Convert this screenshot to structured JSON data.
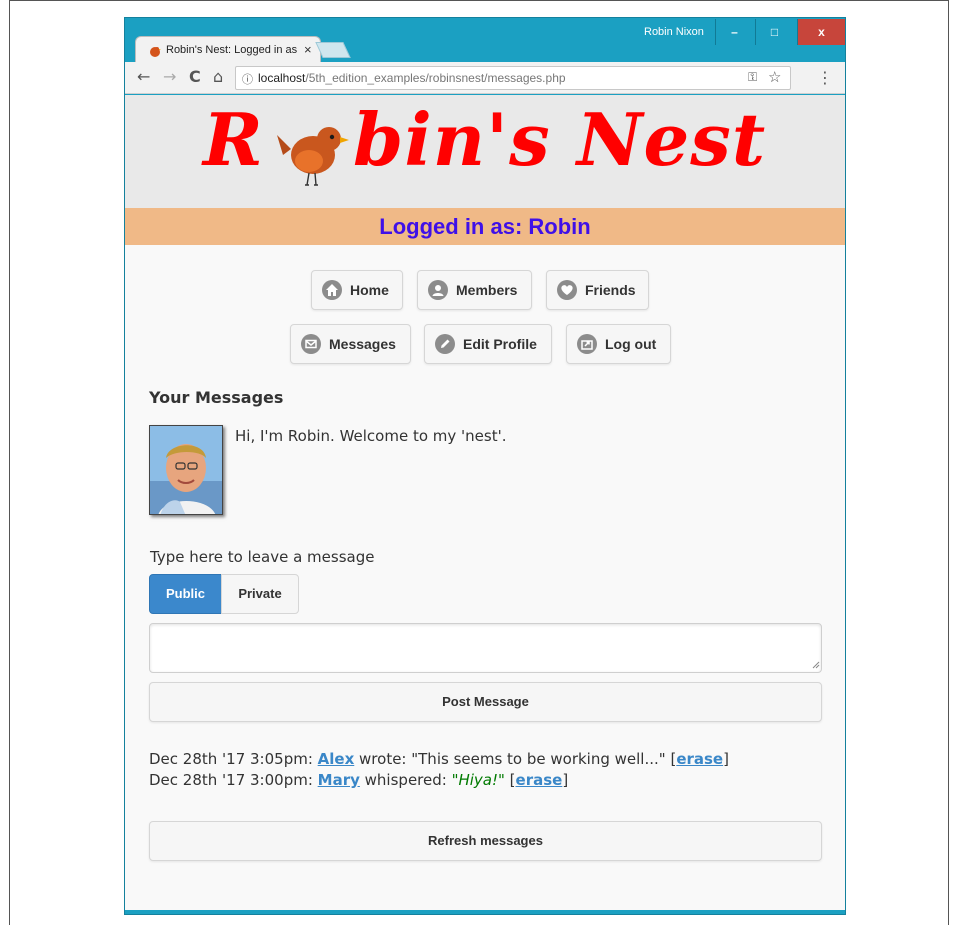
{
  "window": {
    "tab_title": "Robin's Nest: Logged in as Robin",
    "tab_close": "×",
    "user_name": "Robin Nixon",
    "controls": {
      "minimize": "–",
      "maximize": "□",
      "close": "x"
    }
  },
  "toolbar": {
    "back": "←",
    "forward": "→",
    "reload": "C",
    "home": "⌂",
    "info": "ⓘ",
    "url_host": "localhost",
    "url_path": "/5th_edition_examples/robinsnest/messages.php",
    "key": "⚿",
    "star": "☆",
    "menu": "⋮"
  },
  "header": {
    "logo_first": "R",
    "logo_rest": "bin's Nest",
    "logged_in": "Logged in as: Robin"
  },
  "nav": {
    "home": "Home",
    "members": "Members",
    "friends": "Friends",
    "messages": "Messages",
    "edit_profile": "Edit Profile",
    "logout": "Log out"
  },
  "messages_page": {
    "title": "Your Messages",
    "greeting": "Hi, I'm Robin. Welcome to my 'nest'.",
    "leave_label": "Type here to leave a message",
    "public_label": "Public",
    "private_label": "Private",
    "input_value": "",
    "post_label": "Post Message",
    "refresh_label": "Refresh messages"
  },
  "message_list": [
    {
      "date": "Dec 28th '17 3:05pm: ",
      "user": "Alex",
      "verb": " wrote: ",
      "text": "\"This seems to be working well...\"",
      "open": " [",
      "erase": "erase",
      "close": "]"
    },
    {
      "date": "Dec 28th '17 3:00pm: ",
      "user": "Mary",
      "verb": " whispered: ",
      "text": "\"Hiya!\"",
      "open": " [",
      "erase": "erase",
      "close": "]"
    }
  ],
  "colors": {
    "logo": "#ff0000",
    "logged_in_text": "#3f10e8",
    "logged_in_bar": "#f0b987",
    "accent": "#3b88cc",
    "whisper": "#007a00",
    "window_frame": "#1ba0c2"
  }
}
